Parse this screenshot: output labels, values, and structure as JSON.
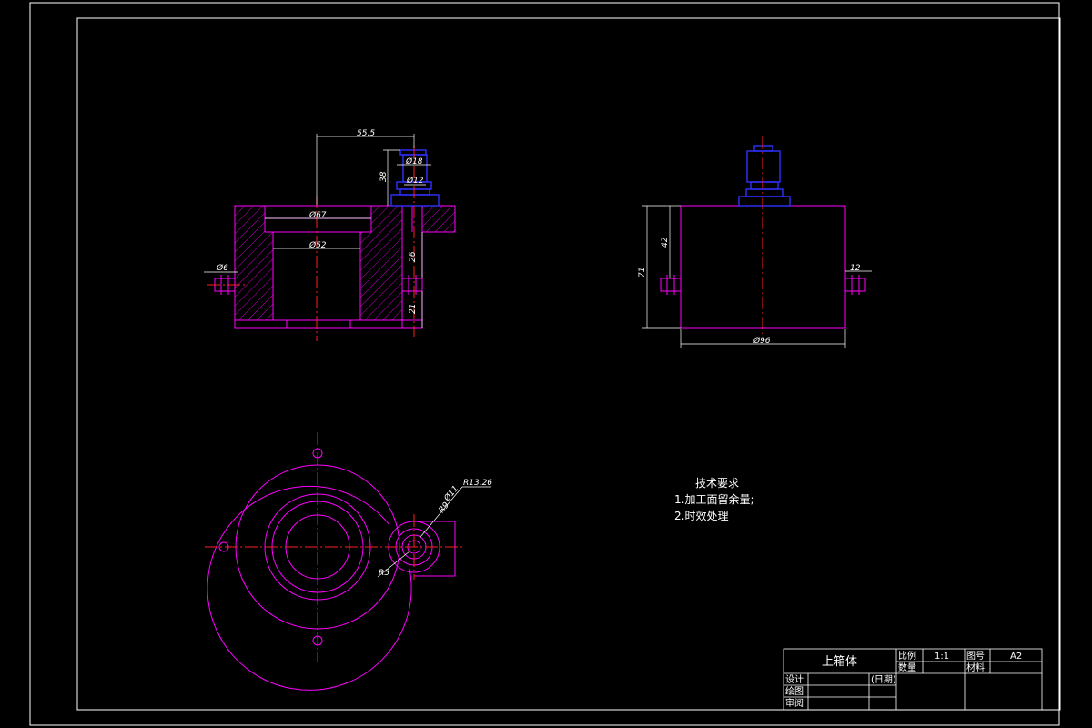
{
  "drawing": {
    "part_name": "上箱体",
    "technical_requirements": {
      "title": "技术要求",
      "items": [
        "1.加工面留余量;",
        "2.时效处理"
      ]
    },
    "dimensions": {
      "front": {
        "d55_5": "55.5",
        "d38": "38",
        "d18": "Ø18",
        "d12": "Ø12",
        "d67": "Ø67",
        "d52": "Ø52",
        "d6": "Ø6",
        "d26": "26",
        "d21": "21"
      },
      "side": {
        "d42": "42",
        "d71": "71",
        "d12": "12",
        "d96": "Ø96"
      },
      "top": {
        "r13_26": "R13.26",
        "d11": "Ø11",
        "r9": "R9",
        "r5": "R5"
      }
    },
    "title_block": {
      "scale_label": "比例",
      "scale_value": "1:1",
      "drawing_no_label": "图号",
      "drawing_no_value": "A2",
      "quantity_label": "数量",
      "material_label": "材料",
      "design_label": "设计",
      "date_label": "(日期)",
      "draw_label": "绘图",
      "review_label": "审阅"
    }
  },
  "colors": {
    "outline": "#ff00ff",
    "centerline": "#ff2020",
    "component": "#3030ff",
    "annotation": "#ffffff",
    "background": "#000000"
  }
}
